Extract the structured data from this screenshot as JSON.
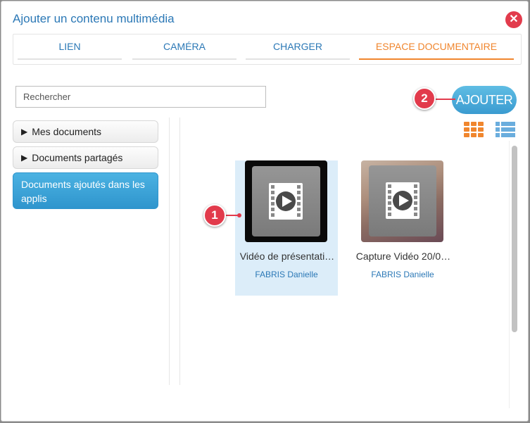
{
  "dialog": {
    "title": "Ajouter un contenu multimédia",
    "close_icon": "close-icon"
  },
  "tabs": [
    {
      "label": "LIEN",
      "active": false
    },
    {
      "label": "CAMÉRA",
      "active": false
    },
    {
      "label": "CHARGER",
      "active": false
    },
    {
      "label": "ESPACE DOCUMENTAIRE",
      "active": true
    }
  ],
  "search": {
    "placeholder": "Rechercher",
    "value": ""
  },
  "actions": {
    "add_label": "AJOUTER"
  },
  "callouts": {
    "one": "1",
    "two": "2"
  },
  "sidebar": {
    "items": [
      {
        "label": "Mes documents",
        "expander": "▶",
        "active": false
      },
      {
        "label": "Documents partagés",
        "expander": "▶",
        "active": false
      },
      {
        "label": "Documents ajoutés dans les applis",
        "expander": "",
        "active": true
      }
    ]
  },
  "view_toggle": {
    "grid_icon": "grid-view-icon",
    "list_icon": "list-view-icon"
  },
  "documents": [
    {
      "title": "Vidéo de présentati…",
      "author": "FABRIS Danielle",
      "selected": true,
      "icon": "video-file-icon"
    },
    {
      "title": "Capture Vidéo 20/0…",
      "author": "FABRIS Danielle",
      "selected": false,
      "icon": "video-file-icon"
    }
  ],
  "colors": {
    "accent_blue": "#2b78b6",
    "active_orange": "#f0862e",
    "callout_red": "#e23b4c",
    "selected_bg": "#dcedf9"
  }
}
